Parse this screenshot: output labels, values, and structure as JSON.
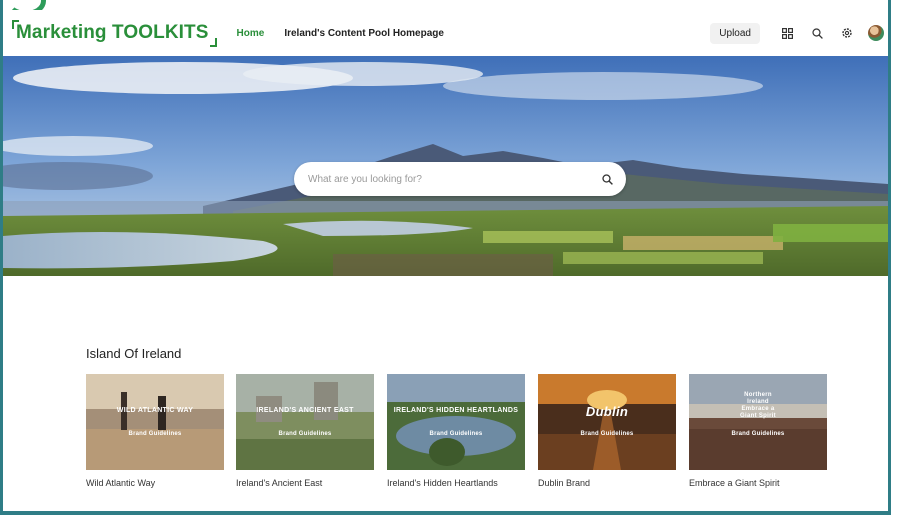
{
  "header": {
    "logo_text": "Marketing TOOLKITS",
    "nav": {
      "home": "Home",
      "content_pool": "Ireland's Content Pool Homepage"
    },
    "upload_label": "Upload",
    "icons": [
      "grid-icon",
      "search-icon",
      "settings-icon",
      "avatar"
    ]
  },
  "hero": {
    "search_placeholder": "What are you looking for?"
  },
  "section": {
    "title": "Island Of Ireland",
    "cards": [
      {
        "caption": "Wild Atlantic Way",
        "brandmark": "WILD ATLANTIC WAY",
        "overlay": "Brand Guidelines"
      },
      {
        "caption": "Ireland's Ancient East",
        "brandmark": "IRELAND'S ANCIENT EAST",
        "overlay": "Brand Guidelines"
      },
      {
        "caption": "Ireland's Hidden Heartlands",
        "brandmark": "IRELAND'S HIDDEN HEARTLANDS",
        "overlay": "Brand Guidelines"
      },
      {
        "caption": "Dublin Brand",
        "brandmark": "Dublin",
        "overlay": "Brand Guidelines"
      },
      {
        "caption": "Embrace a Giant Spirit",
        "brandmark": "Northern Ireland Embrace a Giant Spirit",
        "overlay": "Brand Guidelines"
      }
    ]
  },
  "colors": {
    "brand_green": "#2a8f3a",
    "frame_teal": "#2f7d86"
  }
}
